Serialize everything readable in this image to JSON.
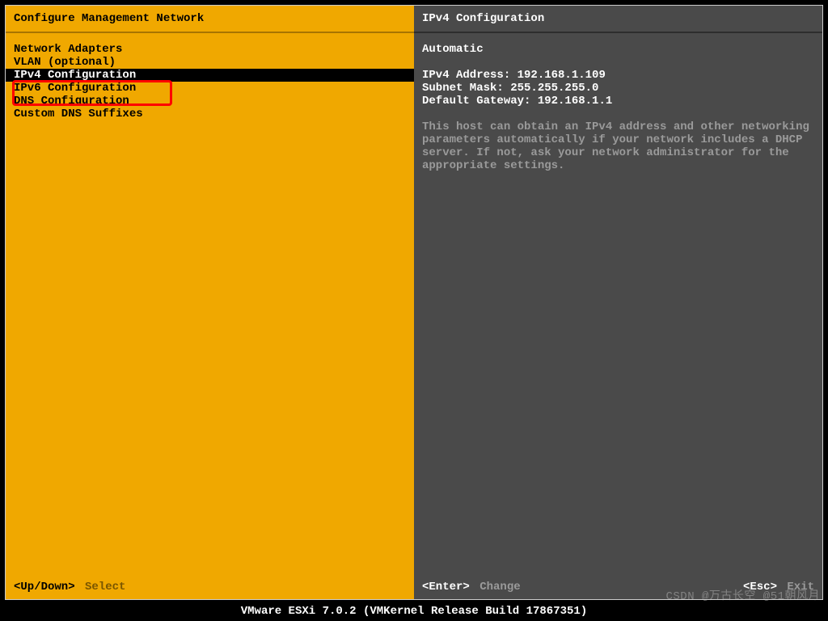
{
  "left": {
    "title": "Configure Management Network",
    "items": [
      {
        "label": "Network Adapters",
        "selected": false
      },
      {
        "label": "VLAN (optional)",
        "selected": false
      },
      {
        "label": "",
        "selected": false
      },
      {
        "label": "IPv4 Configuration",
        "selected": true
      },
      {
        "label": "IPv6 Configuration",
        "selected": false
      },
      {
        "label": "DNS Configuration",
        "selected": false
      },
      {
        "label": "Custom DNS Suffixes",
        "selected": false
      }
    ],
    "footer": {
      "key": "<Up/Down>",
      "action": "Select"
    }
  },
  "right": {
    "title": "IPv4 Configuration",
    "mode": "Automatic",
    "address_label": "IPv4 Address: ",
    "address_value": "192.168.1.109",
    "mask_label": "Subnet Mask: ",
    "mask_value": "255.255.255.0",
    "gw_label": "Default Gateway: ",
    "gw_value": "192.168.1.1",
    "help": "This host can obtain an IPv4 address and other networking parameters automatically if your network includes a DHCP server. If not, ask your network administrator for the appropriate settings.",
    "footer_left": {
      "key": "<Enter>",
      "action": "Change"
    },
    "footer_right": {
      "key": "<Esc>",
      "action": "Exit"
    }
  },
  "status_bar": "VMware ESXi 7.0.2 (VMKernel Release Build 17867351)",
  "watermark": "CSDN @万古长空 @51朝风月"
}
